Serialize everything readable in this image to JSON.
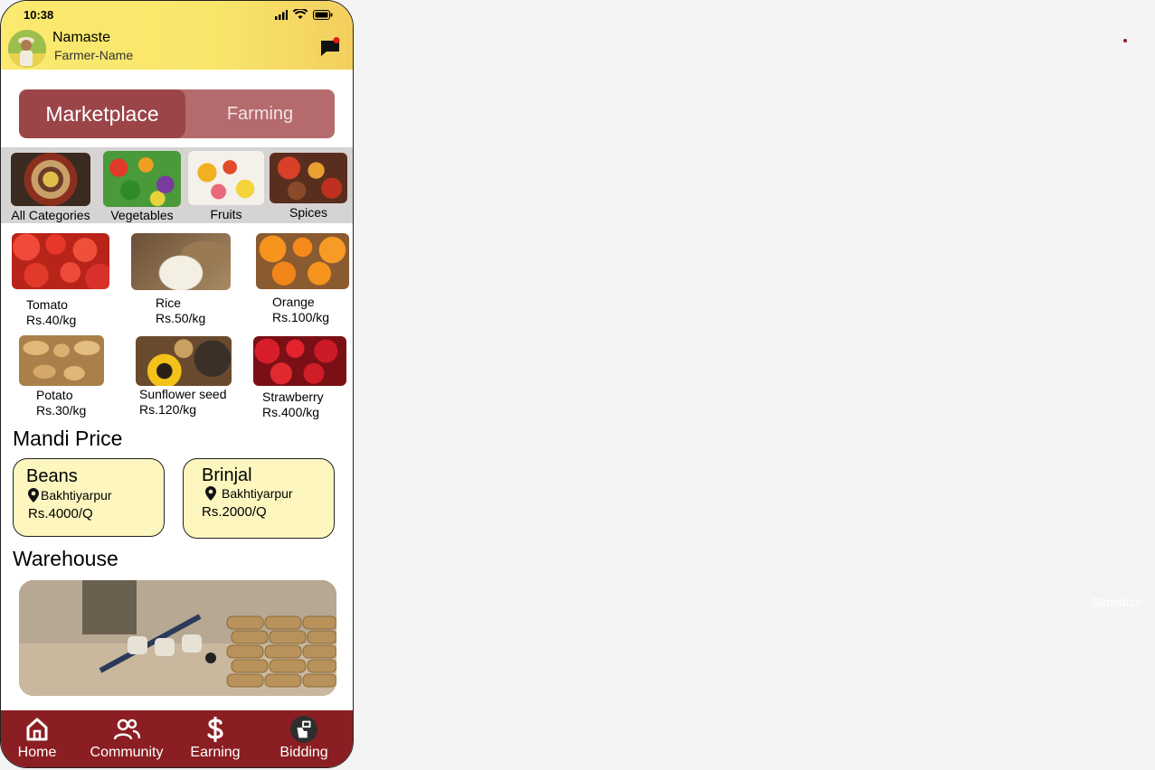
{
  "status": {
    "time": "10:38"
  },
  "header": {
    "greeting": "Namaste",
    "farmer_name": "Farmer-Name"
  },
  "toggle": {
    "active": "Marketplace",
    "inactive": "Farming"
  },
  "categories": [
    {
      "label": "All Categories"
    },
    {
      "label": "Vegetables"
    },
    {
      "label": "Fruits"
    },
    {
      "label": "Spices"
    }
  ],
  "products": [
    {
      "name": "Tomato",
      "price": "Rs.40/kg"
    },
    {
      "name": "Rice",
      "price": "Rs.50/kg"
    },
    {
      "name": "Orange",
      "price": "Rs.100/kg"
    },
    {
      "name": "Potato",
      "price": "Rs.30/kg"
    },
    {
      "name": "Sunflower seed",
      "price": "Rs.120/kg"
    },
    {
      "name": "Strawberry",
      "price": "Rs.400/kg"
    }
  ],
  "mandi": {
    "title": "Mandi Price",
    "items": [
      {
        "name": "Beans",
        "location": "Bakhtiyarpur",
        "price": "Rs.4000/Q"
      },
      {
        "name": "Brinjal",
        "location": "Bakhtiyarpur",
        "price": "Rs.2000/Q"
      }
    ]
  },
  "warehouse": {
    "title": "Warehouse"
  },
  "nav": [
    {
      "label": "Home",
      "icon": "home-icon"
    },
    {
      "label": "Community",
      "icon": "community-icon"
    },
    {
      "label": "Earning",
      "icon": "dollar-icon"
    },
    {
      "label": "Bidding",
      "icon": "bidding-icon"
    }
  ],
  "side": {
    "statistics": "Statistics"
  },
  "colors": {
    "header": "#fbe970",
    "toggle_active": "#9b4549",
    "toggle_bg": "#b56a6d",
    "nav": "#8b1e22",
    "mandi_card": "#fdf6bf"
  }
}
